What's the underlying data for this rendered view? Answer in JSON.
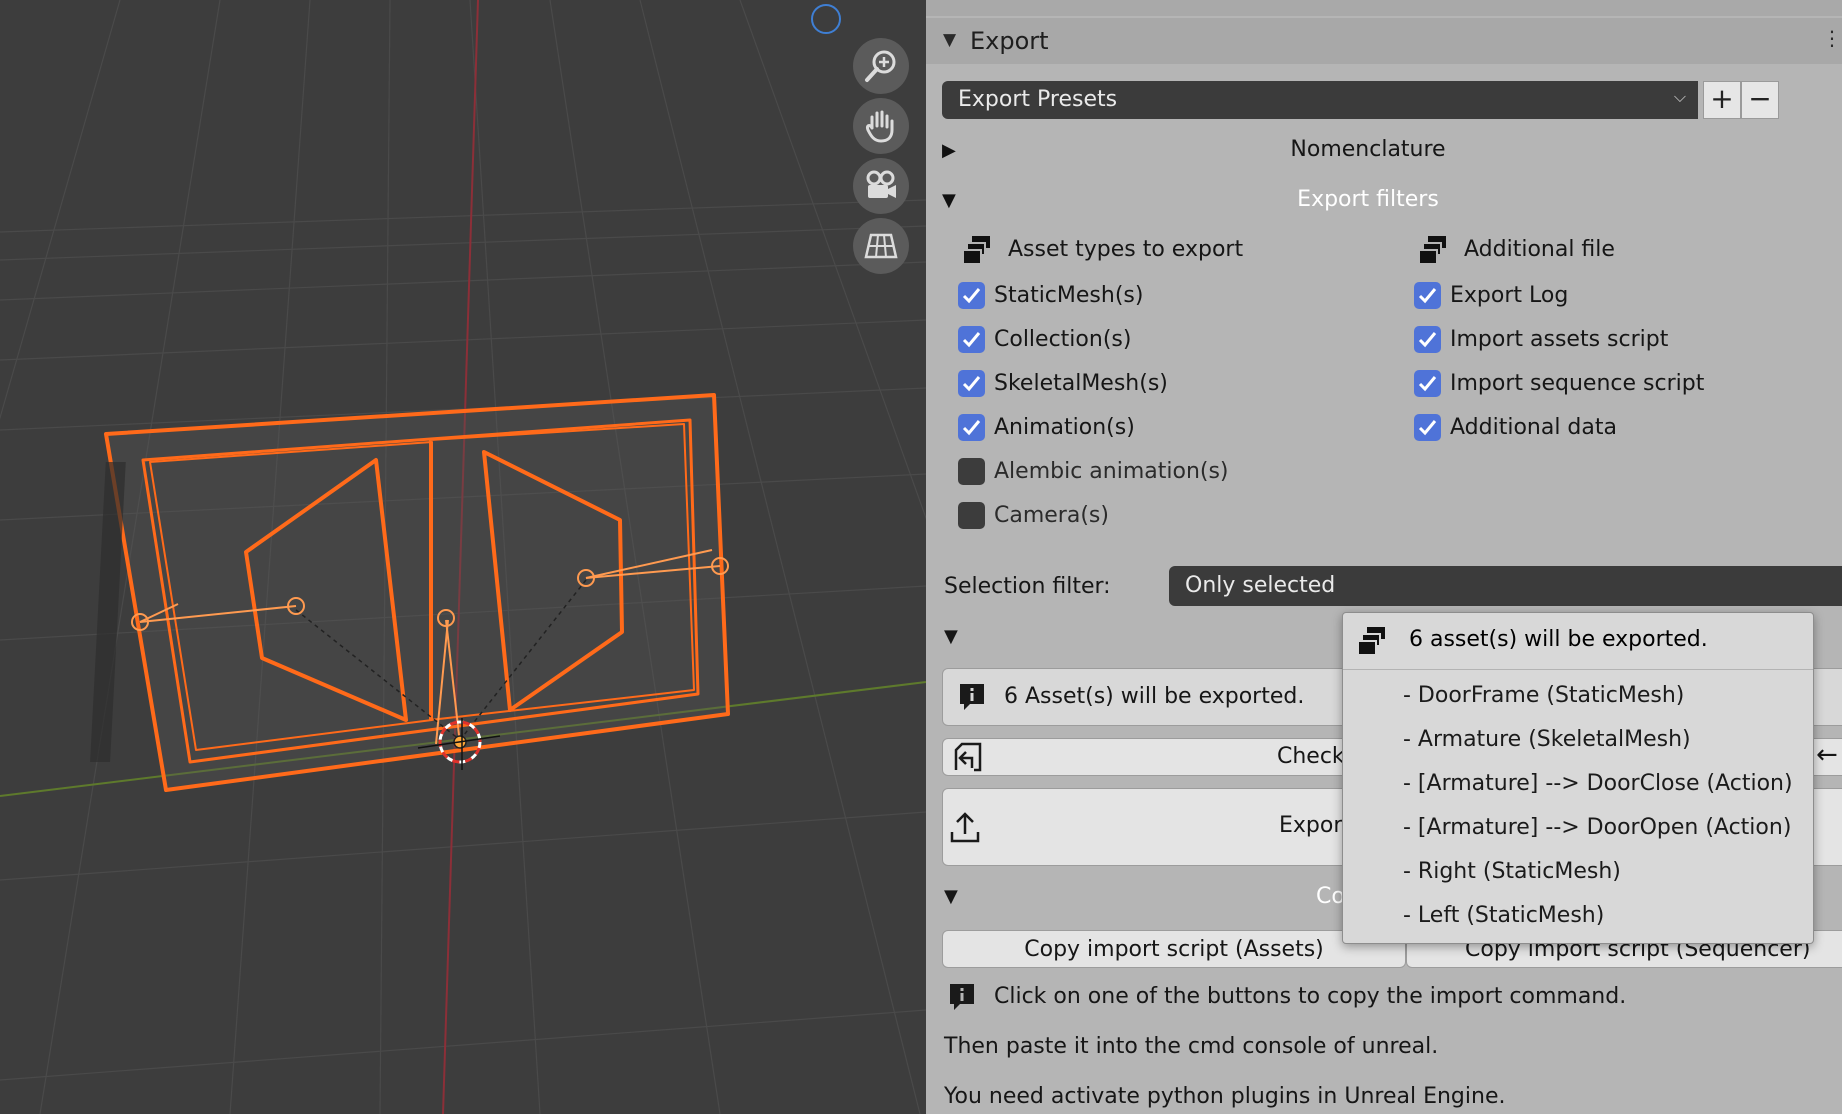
{
  "panel": {
    "title": "Export",
    "menu_dots": "⋮",
    "presets": {
      "label": "Export Presets",
      "add": "+",
      "remove": "−"
    },
    "nomenclature": "Nomenclature",
    "export_filters": "Export filters",
    "asset_types": {
      "heading": "Asset types to export",
      "items": [
        {
          "label": "StaticMesh(s)",
          "checked": true
        },
        {
          "label": "Collection(s)",
          "checked": true
        },
        {
          "label": "SkeletalMesh(s)",
          "checked": true
        },
        {
          "label": "Animation(s)",
          "checked": true
        },
        {
          "label": "Alembic animation(s)",
          "checked": false
        },
        {
          "label": "Camera(s)",
          "checked": false
        }
      ]
    },
    "additional_file": {
      "heading": "Additional file",
      "items": [
        {
          "label": "Export Log",
          "checked": true
        },
        {
          "label": "Import assets script",
          "checked": true
        },
        {
          "label": "Import sequence script",
          "checked": true
        },
        {
          "label": "Additional data",
          "checked": true
        }
      ]
    },
    "selection_filter": {
      "label": "Selection filter:",
      "value": "Only selected"
    },
    "asset_count_bar": "6 Asset(s) will be exported.",
    "check_button": "Check",
    "export_button": "Expor",
    "copy_section_label": "Co",
    "copy_assets_button": "Copy import script (Assets)",
    "copy_sequencer_button": "Copy import script (Sequencer)",
    "info_lines": [
      "Click on one of the buttons to copy the import command.",
      "Then paste it into the cmd console of unreal.",
      "You need activate python plugins in Unreal Engine."
    ]
  },
  "popup": {
    "heading": "6 asset(s) will be exported.",
    "items": [
      "- DoorFrame (StaticMesh)",
      "- Armature (SkeletalMesh)",
      "- [Armature] --> DoorClose (Action)",
      "- [Armature] --> DoorOpen (Action)",
      "- Right (StaticMesh)",
      "- Left (StaticMesh)"
    ]
  },
  "viewport": {
    "nav_buttons": [
      "zoom-icon",
      "pan-hand-icon",
      "camera-icon",
      "grid-view-icon"
    ],
    "selection_color": "#ff6a1a"
  },
  "colors": {
    "accent": "#4f73d8",
    "panel_bg": "#b5b5b5",
    "dark_field": "#3b3b3b"
  }
}
